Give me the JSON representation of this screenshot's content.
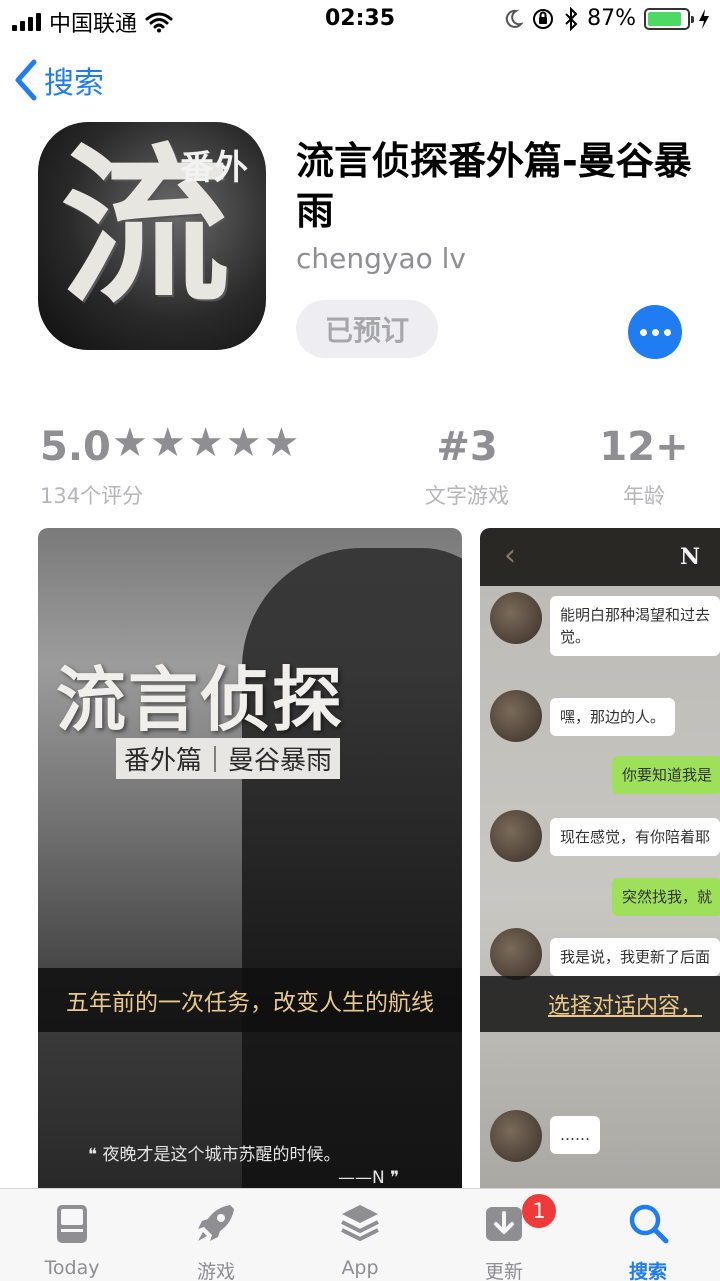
{
  "status_bar": {
    "carrier": "中国联通",
    "time": "02:35",
    "battery_percent": "87%",
    "battery_level": 0.87
  },
  "nav": {
    "back_label": "搜索"
  },
  "app": {
    "title": "流言侦探番外篇-曼谷暴雨",
    "developer": "chengyao lv",
    "preorder_label": "已预订",
    "icon_big_char": "流",
    "icon_small_text": "番外"
  },
  "ratings": {
    "score": "5.0",
    "stars": "★★★★★",
    "count_label": "134个评分",
    "rank": "#3",
    "rank_label": "文字游戏",
    "age": "12+",
    "age_label": "年龄"
  },
  "screenshot1": {
    "title": "流言侦探",
    "subtitle": "番外篇｜曼谷暴雨",
    "banner": "五年前的一次任务，改变人生的航线",
    "quote": "❝ 夜晚才是这个城市苏醒的时候。",
    "quote_by": "——N ❞"
  },
  "screenshot2": {
    "header_letter": "N",
    "back_glyph": "‹",
    "messages": [
      "能明白那种渴望和过去",
      "觉。",
      "嘿，那边的人。",
      "你要知道我是",
      "现在感觉，有你陪着耶",
      "突然找我，就",
      "我是说，我更新了后面",
      "……"
    ],
    "banner": "选择对话内容，"
  },
  "tabbar": {
    "tabs": [
      {
        "label": "Today",
        "icon": "today-icon"
      },
      {
        "label": "游戏",
        "icon": "rocket-icon"
      },
      {
        "label": "App",
        "icon": "layers-icon"
      },
      {
        "label": "更新",
        "icon": "download-icon"
      },
      {
        "label": "搜索",
        "icon": "search-icon"
      }
    ],
    "updates_badge": "1",
    "active_color": "#1f7cf2",
    "inactive_color": "#8e8e93"
  }
}
